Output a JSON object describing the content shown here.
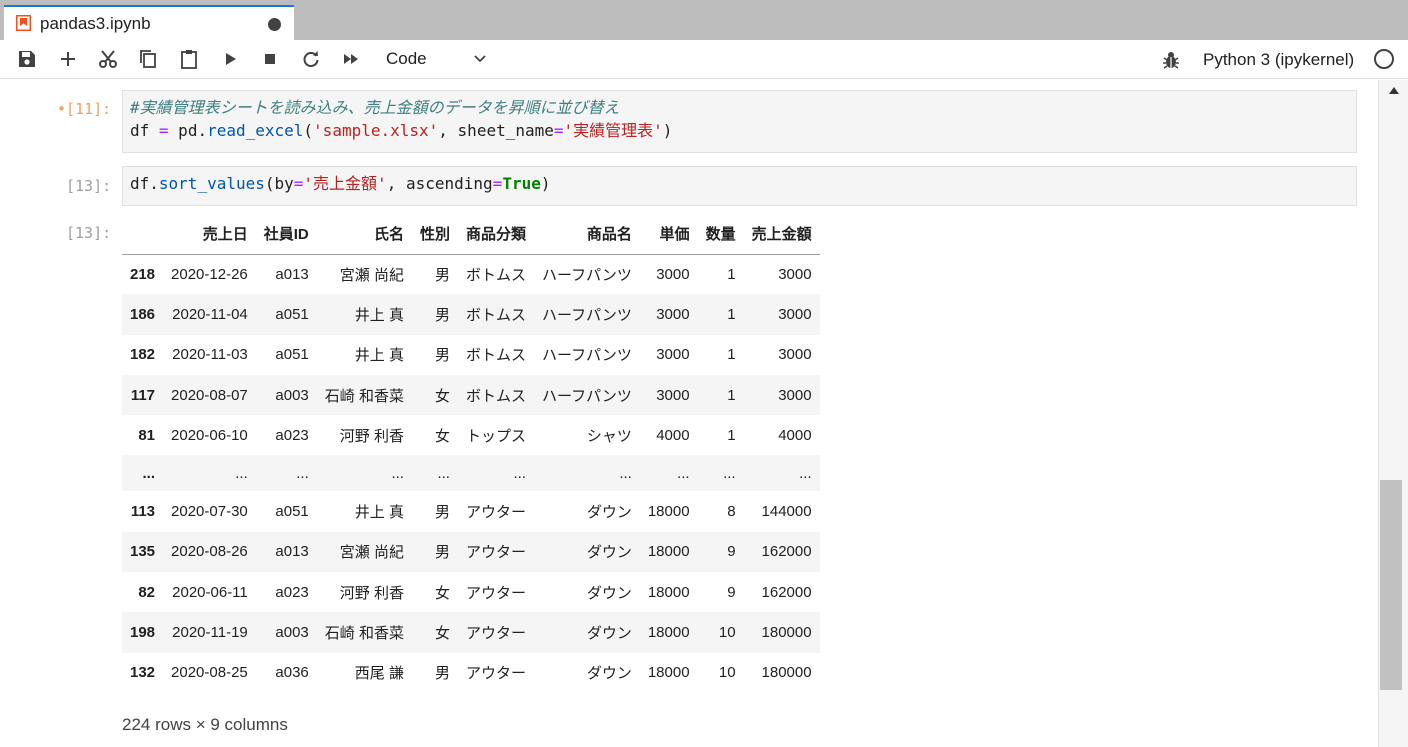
{
  "tab": {
    "title": "pandas3.ipynb"
  },
  "toolbar": {
    "cell_type": "Code",
    "kernel_name": "Python 3 (ipykernel)",
    "icons": [
      "save-icon",
      "add-icon",
      "cut-icon",
      "copy-icon",
      "paste-icon",
      "run-icon",
      "stop-icon",
      "restart-icon",
      "fast-forward-icon",
      "chevron-down-icon",
      "bug-icon",
      "kernel-status-icon"
    ]
  },
  "cells": [
    {
      "prompt": "•[11]:",
      "lines": [
        {
          "comment": "#実績管理表シートを読み込み、売上金額のデータを昇順に並び替え"
        },
        {
          "p1": "df ",
          "op": "=",
          "p2": " pd.",
          "attr": "read_excel",
          "p3": "(",
          "s1": "'sample.xlsx'",
          "p4": ", sheet_name",
          "op2": "=",
          "s2": "'実績管理表'",
          "p5": ")"
        }
      ]
    },
    {
      "prompt": "[13]:",
      "lines": [
        {
          "p1": "df.",
          "attr": "sort_values",
          "p2": "(by",
          "op": "=",
          "s1": "'売上金額'",
          "p3": ", ascending",
          "op2": "=",
          "kw": "True",
          "p4": ")"
        }
      ]
    }
  ],
  "output": {
    "prompt": "[13]:",
    "columns": [
      "",
      "売上日",
      "社員ID",
      "氏名",
      "性別",
      "商品分類",
      "商品名",
      "単価",
      "数量",
      "売上金額"
    ],
    "rows": [
      [
        "218",
        "2020-12-26",
        "a013",
        "宮瀬 尚紀",
        "男",
        "ボトムス",
        "ハーフパンツ",
        "3000",
        "1",
        "3000"
      ],
      [
        "186",
        "2020-11-04",
        "a051",
        "井上 真",
        "男",
        "ボトムス",
        "ハーフパンツ",
        "3000",
        "1",
        "3000"
      ],
      [
        "182",
        "2020-11-03",
        "a051",
        "井上 真",
        "男",
        "ボトムス",
        "ハーフパンツ",
        "3000",
        "1",
        "3000"
      ],
      [
        "117",
        "2020-08-07",
        "a003",
        "石崎 和香菜",
        "女",
        "ボトムス",
        "ハーフパンツ",
        "3000",
        "1",
        "3000"
      ],
      [
        "81",
        "2020-06-10",
        "a023",
        "河野 利香",
        "女",
        "トップス",
        "シャツ",
        "4000",
        "1",
        "4000"
      ],
      [
        "...",
        "...",
        "...",
        "...",
        "...",
        "...",
        "...",
        "...",
        "...",
        "..."
      ],
      [
        "113",
        "2020-07-30",
        "a051",
        "井上 真",
        "男",
        "アウター",
        "ダウン",
        "18000",
        "8",
        "144000"
      ],
      [
        "135",
        "2020-08-26",
        "a013",
        "宮瀬 尚紀",
        "男",
        "アウター",
        "ダウン",
        "18000",
        "9",
        "162000"
      ],
      [
        "82",
        "2020-06-11",
        "a023",
        "河野 利香",
        "女",
        "アウター",
        "ダウン",
        "18000",
        "9",
        "162000"
      ],
      [
        "198",
        "2020-11-19",
        "a003",
        "石崎 和香菜",
        "女",
        "アウター",
        "ダウン",
        "18000",
        "10",
        "180000"
      ],
      [
        "132",
        "2020-08-25",
        "a036",
        "西尾 謙",
        "男",
        "アウター",
        "ダウン",
        "18000",
        "10",
        "180000"
      ]
    ],
    "shape": "224 rows × 9 columns"
  }
}
